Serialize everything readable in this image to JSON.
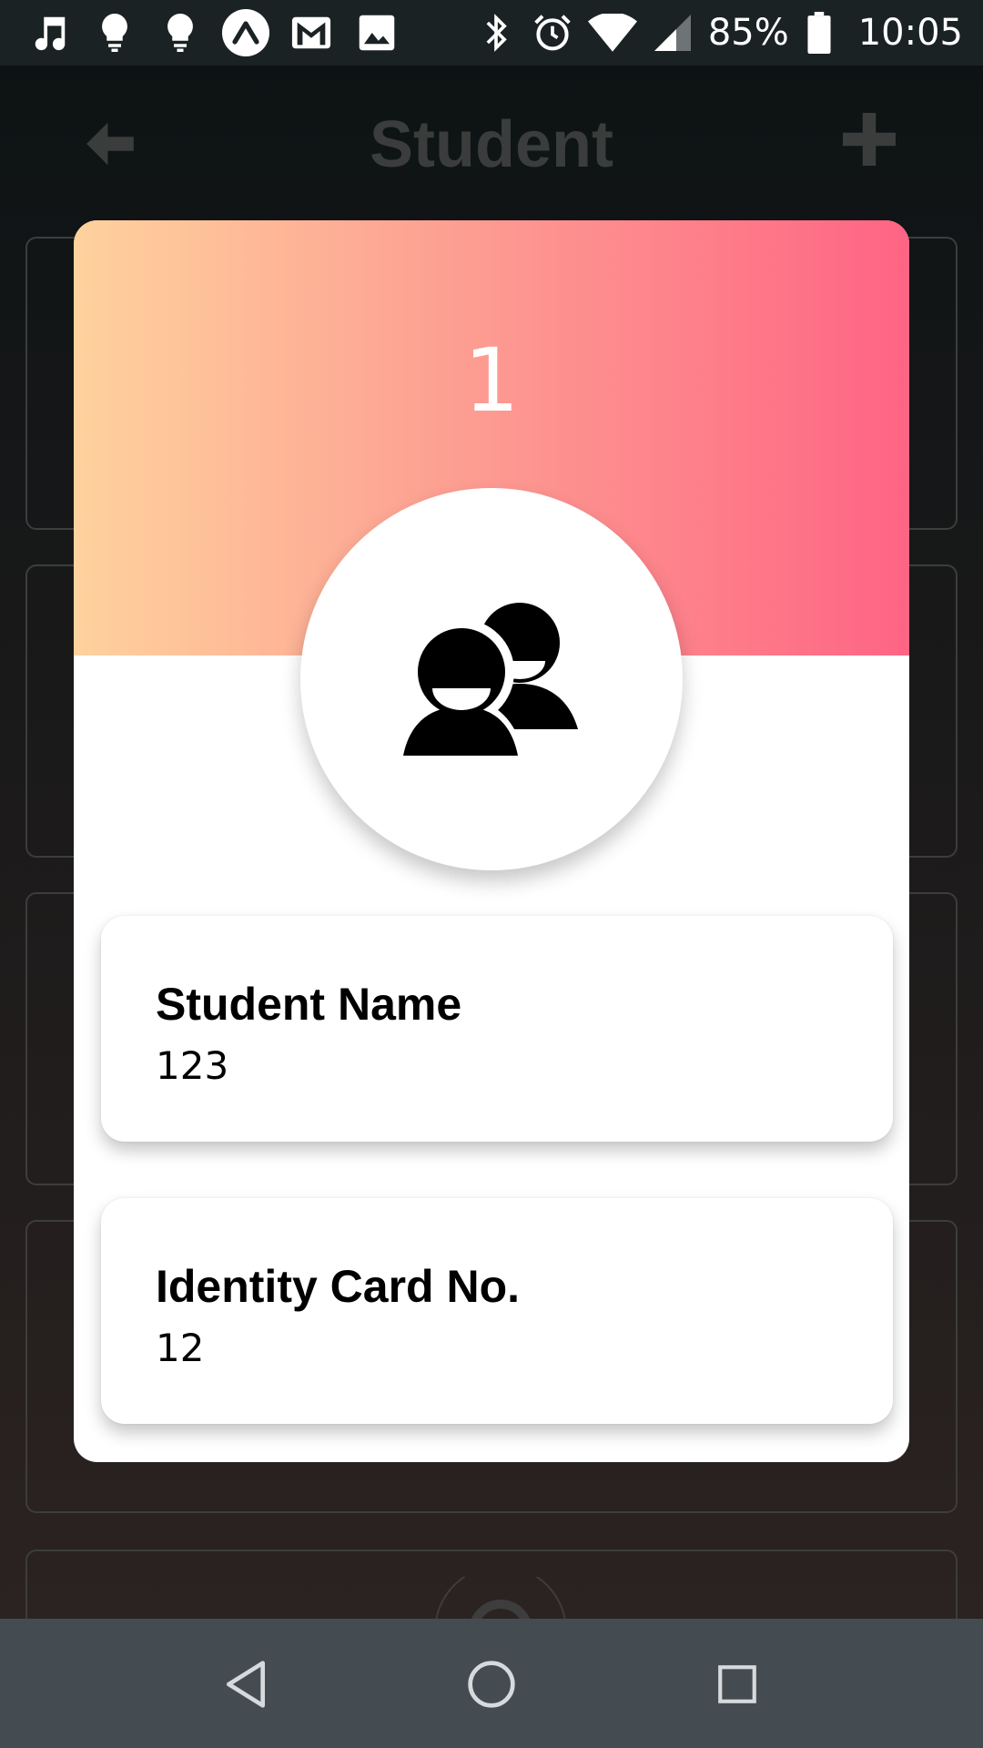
{
  "status_bar": {
    "left_icons": [
      "music-note-icon",
      "lightbulb-icon",
      "lightbulb-icon",
      "expo-icon",
      "gmail-icon",
      "image-icon"
    ],
    "right_icons": [
      "bluetooth-icon",
      "alarm-icon",
      "wifi-icon",
      "signal-icon"
    ],
    "battery": "85%",
    "time": "10:05"
  },
  "header": {
    "title": "Student",
    "back_icon": "arrow-left-icon",
    "add_icon": "plus-icon"
  },
  "modal": {
    "number": "1",
    "avatar_icon": "users-icon",
    "fields": [
      {
        "label": "Student Name",
        "value": "123"
      },
      {
        "label": "Identity Card No.",
        "value": "12"
      }
    ]
  },
  "nav_bar": {
    "buttons": [
      "back-triangle-icon",
      "home-circle-icon",
      "recents-square-icon"
    ]
  },
  "colors": {
    "gradient_start": "#fed29d",
    "gradient_end": "#fe6484",
    "nav_bg": "#454c51",
    "status_bg": "#1b2224"
  }
}
